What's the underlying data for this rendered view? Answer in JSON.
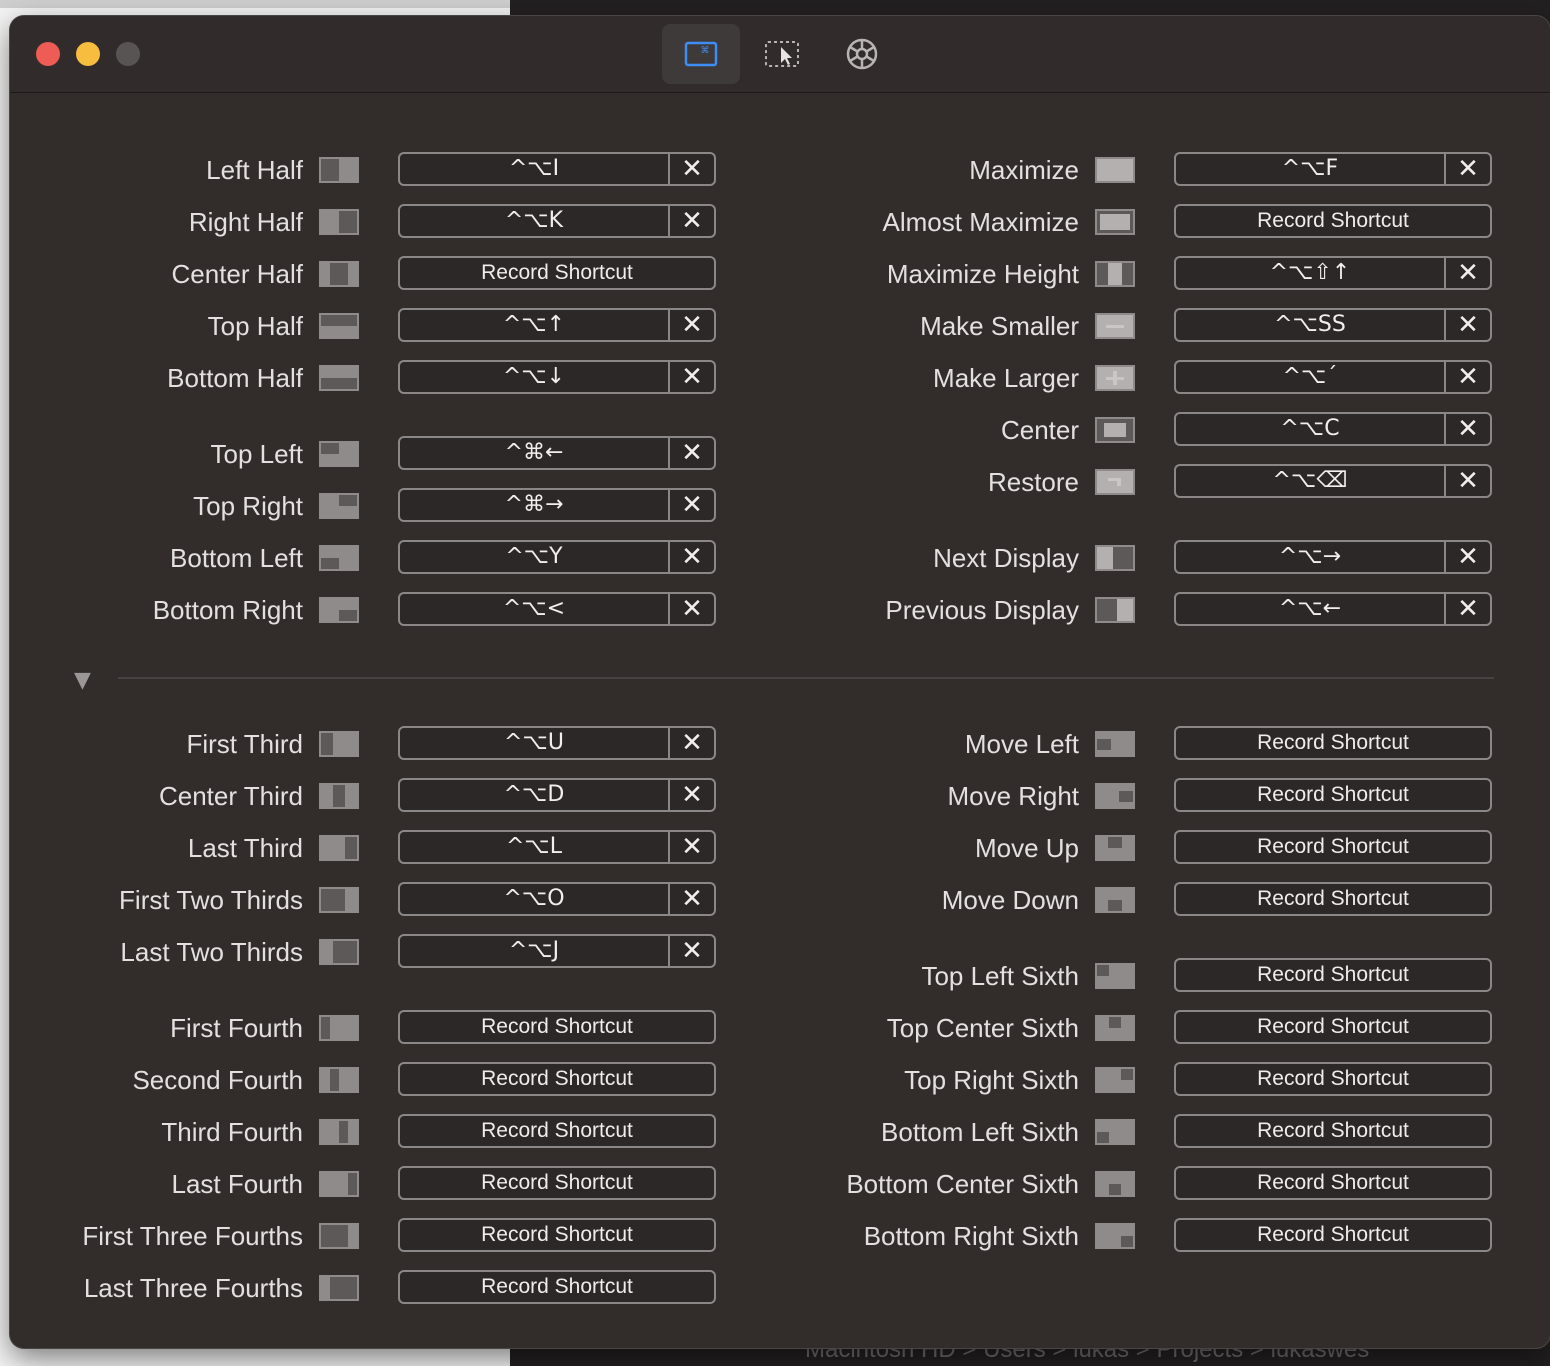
{
  "background": {
    "path_items": [
      "Macintosh HD",
      "Users",
      "lukas",
      "Projects",
      "lukaswes"
    ],
    "path_separator": ">"
  },
  "window": {
    "toolbar_tabs": [
      {
        "name": "keyboard-shortcuts",
        "icon": "command-window-icon",
        "selected": true
      },
      {
        "name": "snap-areas",
        "icon": "cursor-window-icon",
        "selected": false
      },
      {
        "name": "settings",
        "icon": "gear-icon",
        "selected": false
      }
    ]
  },
  "clear_symbol": "✕",
  "record_label": "Record Shortcut",
  "shortcuts": {
    "left_top": [
      {
        "label": "Left Half",
        "icon": "left-half",
        "shortcut": "^⌥I"
      },
      {
        "label": "Right Half",
        "icon": "right-half",
        "shortcut": "^⌥K"
      },
      {
        "label": "Center Half",
        "icon": "center-half",
        "shortcut": null
      },
      {
        "label": "Top Half",
        "icon": "top-half",
        "shortcut": "^⌥↑"
      },
      {
        "label": "Bottom Half",
        "icon": "bottom-half",
        "shortcut": "^⌥↓"
      },
      {
        "label": "Top Left",
        "icon": "top-left",
        "shortcut": "^⌘←"
      },
      {
        "label": "Top Right",
        "icon": "top-right",
        "shortcut": "^⌘→"
      },
      {
        "label": "Bottom Left",
        "icon": "bottom-left",
        "shortcut": "^⌥Y"
      },
      {
        "label": "Bottom Right",
        "icon": "bottom-right",
        "shortcut": "^⌥<"
      }
    ],
    "right_top": [
      {
        "label": "Maximize",
        "icon": "maximize",
        "shortcut": "^⌥F"
      },
      {
        "label": "Almost Maximize",
        "icon": "almost-maximize",
        "shortcut": null
      },
      {
        "label": "Maximize Height",
        "icon": "maximize-height",
        "shortcut": "^⌥⇧↑"
      },
      {
        "label": "Make Smaller",
        "icon": "make-smaller",
        "shortcut": "^⌥SS"
      },
      {
        "label": "Make Larger",
        "icon": "make-larger",
        "shortcut": "^⌥´"
      },
      {
        "label": "Center",
        "icon": "center",
        "shortcut": "^⌥C"
      },
      {
        "label": "Restore",
        "icon": "restore",
        "shortcut": "^⌥⌫"
      },
      {
        "label": "Next Display",
        "icon": "next-display",
        "shortcut": "^⌥→"
      },
      {
        "label": "Previous Display",
        "icon": "previous-display",
        "shortcut": "^⌥←"
      }
    ],
    "left_bottom": [
      {
        "label": "First Third",
        "icon": "first-third",
        "shortcut": "^⌥U"
      },
      {
        "label": "Center Third",
        "icon": "center-third",
        "shortcut": "^⌥D"
      },
      {
        "label": "Last Third",
        "icon": "last-third",
        "shortcut": "^⌥L"
      },
      {
        "label": "First Two Thirds",
        "icon": "first-two-thirds",
        "shortcut": "^⌥O"
      },
      {
        "label": "Last Two Thirds",
        "icon": "last-two-thirds",
        "shortcut": "^⌥J"
      },
      {
        "label": "First Fourth",
        "icon": "first-fourth",
        "shortcut": null
      },
      {
        "label": "Second Fourth",
        "icon": "second-fourth",
        "shortcut": null
      },
      {
        "label": "Third Fourth",
        "icon": "third-fourth",
        "shortcut": null
      },
      {
        "label": "Last Fourth",
        "icon": "last-fourth",
        "shortcut": null
      },
      {
        "label": "First Three Fourths",
        "icon": "first-three-fourths",
        "shortcut": null
      },
      {
        "label": "Last Three Fourths",
        "icon": "last-three-fourths",
        "shortcut": null
      }
    ],
    "right_bottom": [
      {
        "label": "Move Left",
        "icon": "move-left",
        "shortcut": null
      },
      {
        "label": "Move Right",
        "icon": "move-right",
        "shortcut": null
      },
      {
        "label": "Move Up",
        "icon": "move-up",
        "shortcut": null
      },
      {
        "label": "Move Down",
        "icon": "move-down",
        "shortcut": null
      },
      {
        "label": "Top Left Sixth",
        "icon": "top-left-sixth",
        "shortcut": null
      },
      {
        "label": "Top Center Sixth",
        "icon": "top-center-sixth",
        "shortcut": null
      },
      {
        "label": "Top Right Sixth",
        "icon": "top-right-sixth",
        "shortcut": null
      },
      {
        "label": "Bottom Left Sixth",
        "icon": "bottom-left-sixth",
        "shortcut": null
      },
      {
        "label": "Bottom Center Sixth",
        "icon": "bottom-center-sixth",
        "shortcut": null
      },
      {
        "label": "Bottom Right Sixth",
        "icon": "bottom-right-sixth",
        "shortcut": null
      }
    ]
  },
  "colors": {
    "window_bg": "#322c2b",
    "close": "#ee5c55",
    "minimize": "#f6bd3f",
    "accent_blue": "#3d8df5"
  }
}
